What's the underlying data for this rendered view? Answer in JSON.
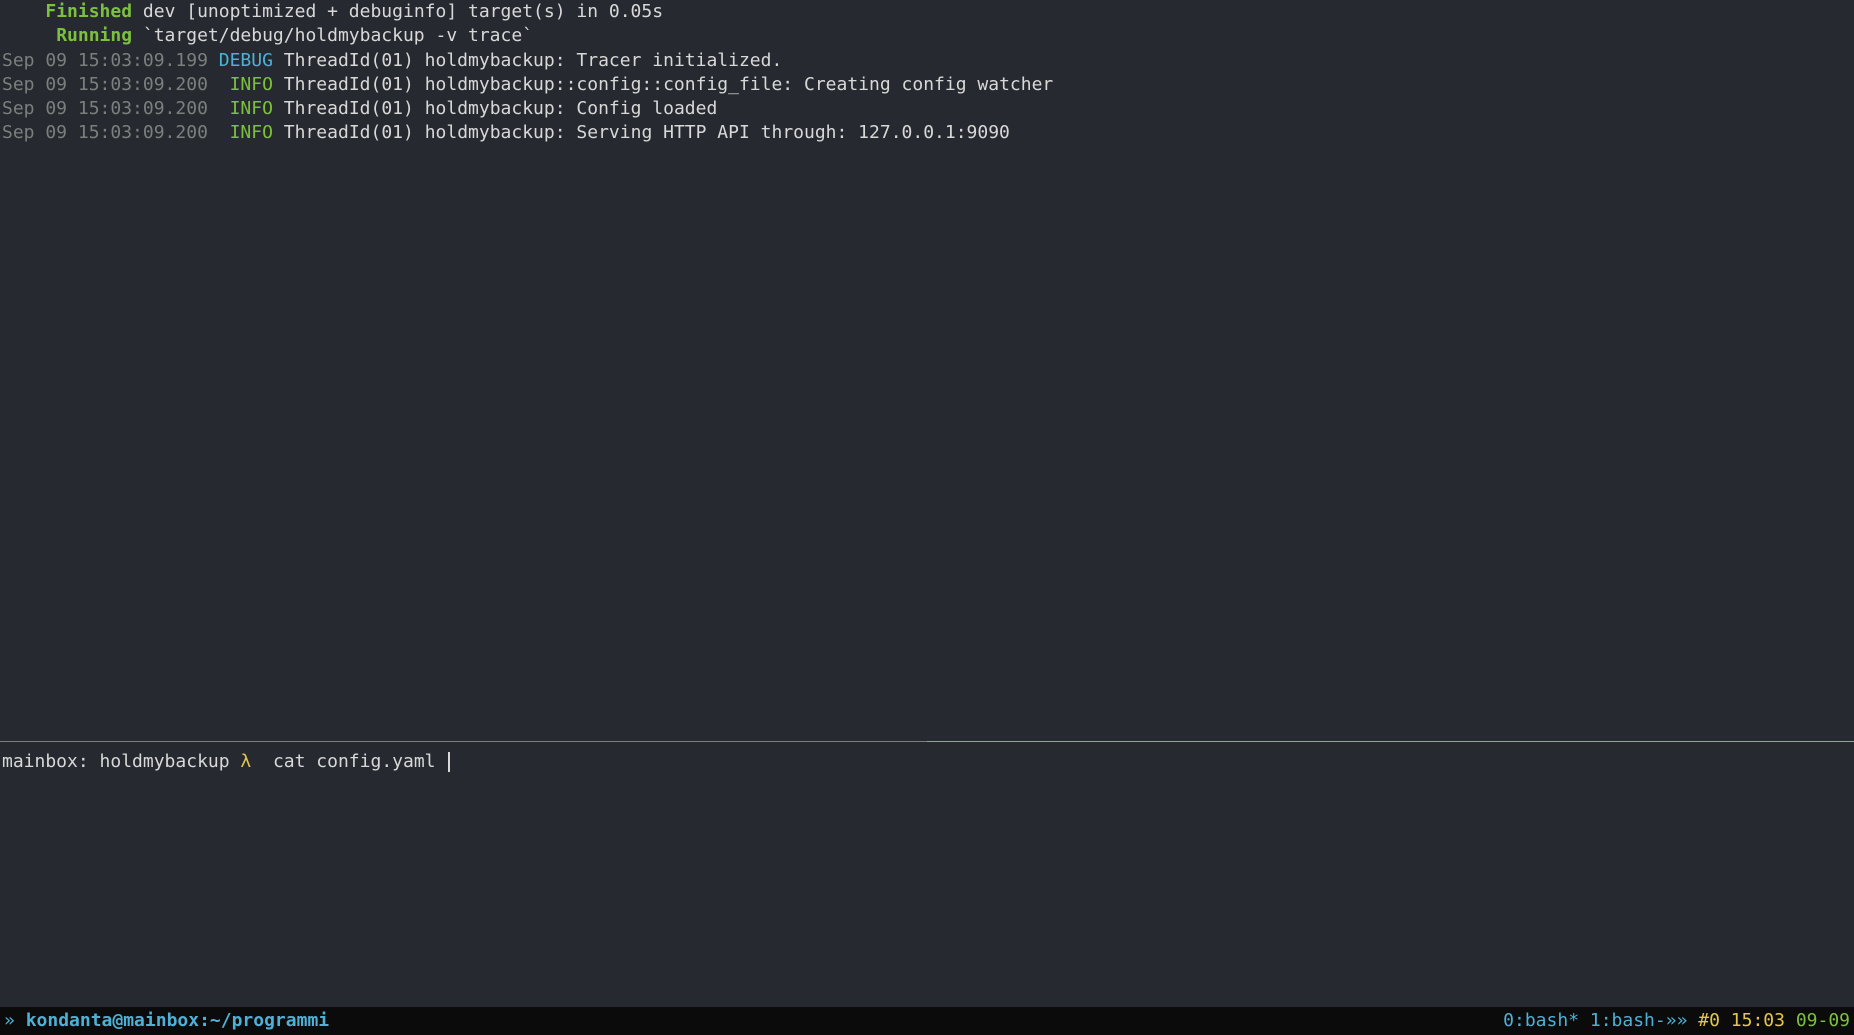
{
  "build": {
    "finished_label": "Finished",
    "finished_text": " dev [unoptimized + debuginfo] target(s) in 0.05s",
    "running_label": "Running",
    "running_text": " `target/debug/holdmybackup -v trace`"
  },
  "logs": [
    {
      "ts": "Sep 09 15:03:09.199",
      "level": "DEBUG",
      "level_class": "cyan-debug",
      "thread": "ThreadId(01)",
      "module": "holdmybackup:",
      "msg": "Tracer initialized."
    },
    {
      "ts": "Sep 09 15:03:09.200",
      "level": "INFO",
      "level_class": "info-green",
      "thread": "ThreadId(01)",
      "module": "holdmybackup::config::config_file:",
      "msg": "Creating config watcher"
    },
    {
      "ts": "Sep 09 15:03:09.200",
      "level": "INFO",
      "level_class": "info-green",
      "thread": "ThreadId(01)",
      "module": "holdmybackup:",
      "msg": "Config loaded"
    },
    {
      "ts": "Sep 09 15:03:09.200",
      "level": "INFO",
      "level_class": "info-green",
      "thread": "ThreadId(01)",
      "module": "holdmybackup:",
      "msg": "Serving HTTP API through: 127.0.0.1:9090"
    }
  ],
  "prompt": {
    "host_path": "mainbox: holdmybackup",
    "lambda": "λ",
    "command": "cat config.yaml"
  },
  "status": {
    "arrow_left": "»",
    "host": "kondanta@mainbox:~/programmi",
    "tabs": "0:bash* 1:bash-»»",
    "hash": "#",
    "idx": "0",
    "time": "15:03",
    "date": "09-09"
  }
}
